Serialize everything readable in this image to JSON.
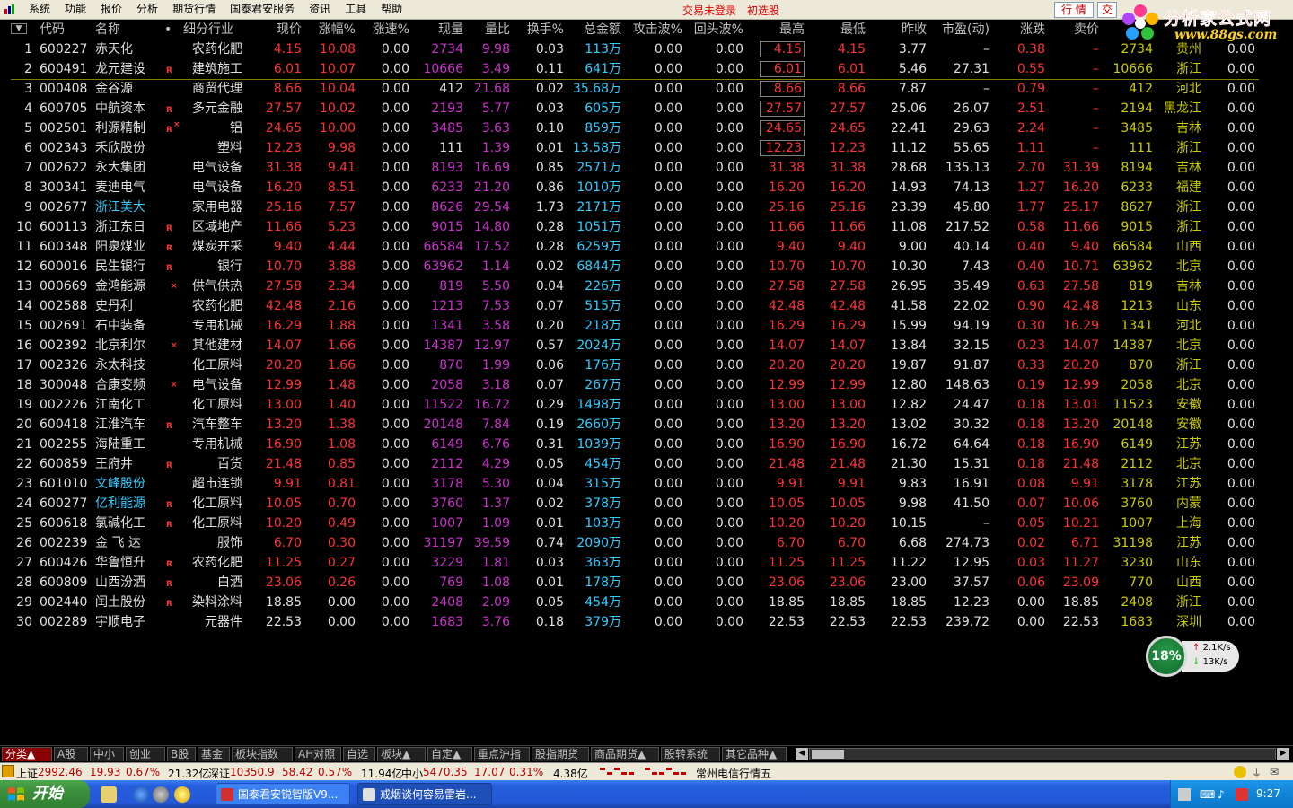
{
  "menubar": {
    "items": [
      "系统",
      "功能",
      "报价",
      "分析",
      "期货行情",
      "国泰君安服务",
      "资讯",
      "工具",
      "帮助"
    ],
    "status_trade": "交易未登录",
    "status_pick": "初选股",
    "hangqing_btn": "行 情",
    "trade_btn": "交易"
  },
  "watermark": {
    "text": "分析家公式网",
    "url": "www.88gs.com"
  },
  "columns": [
    "代码",
    "名称",
    "•",
    "细分行业",
    "现价",
    "涨幅%",
    "涨速%",
    "现量",
    "量比",
    "换手%",
    "总金额",
    "攻击波%",
    "回头波%",
    "最高",
    "最低",
    "昨收",
    "市盈(动)",
    "涨跌",
    "卖价",
    "",
    "",
    ""
  ],
  "rows": [
    {
      "n": "1",
      "code": "600227",
      "name": "赤天化",
      "flag": "",
      "ind": "农药化肥",
      "price": "4.15",
      "pct": "10.08",
      "spd": "0.00",
      "vol": "2734",
      "vr": "9.98",
      "turn": "0.03",
      "amt": "113万",
      "atk": "0.00",
      "bk": "0.00",
      "hi": "4.15",
      "lo": "4.15",
      "pc": "3.77",
      "pe": "–",
      "chg": "0.38",
      "sell": "–",
      "bvol": "2734",
      "area": "贵州",
      "last": "0.00",
      "hibox": true
    },
    {
      "n": "2",
      "code": "600491",
      "name": "龙元建设",
      "flag": "R",
      "ind": "建筑施工",
      "price": "6.01",
      "pct": "10.07",
      "spd": "0.00",
      "vol": "10666",
      "vr": "3.49",
      "turn": "0.11",
      "amt": "641万",
      "atk": "0.00",
      "bk": "0.00",
      "hi": "6.01",
      "lo": "6.01",
      "pc": "5.46",
      "pe": "27.31",
      "chg": "0.55",
      "sell": "–",
      "bvol": "10666",
      "area": "浙江",
      "last": "0.00",
      "hibox": true
    },
    {
      "n": "3",
      "code": "000408",
      "name": "金谷源",
      "flag": "",
      "ind": "商贸代理",
      "price": "8.66",
      "pct": "10.04",
      "spd": "0.00",
      "vol": "412",
      "vr": "21.68",
      "turn": "0.02",
      "amt": "35.68万",
      "atk": "0.00",
      "bk": "0.00",
      "hi": "8.66",
      "lo": "8.66",
      "pc": "7.87",
      "pe": "–",
      "chg": "0.79",
      "sell": "–",
      "bvol": "412",
      "area": "河北",
      "last": "0.00",
      "hibox": true,
      "volw": true
    },
    {
      "n": "4",
      "code": "600705",
      "name": "中航资本",
      "flag": "R",
      "ind": "多元金融",
      "price": "27.57",
      "pct": "10.02",
      "spd": "0.00",
      "vol": "2193",
      "vr": "5.77",
      "turn": "0.03",
      "amt": "605万",
      "atk": "0.00",
      "bk": "0.00",
      "hi": "27.57",
      "lo": "27.57",
      "pc": "25.06",
      "pe": "26.07",
      "chg": "2.51",
      "sell": "–",
      "bvol": "2194",
      "area": "黑龙江",
      "last": "0.00",
      "hibox": true
    },
    {
      "n": "5",
      "code": "002501",
      "name": "利源精制",
      "flag": "R",
      "star": true,
      "ind": "铝",
      "price": "24.65",
      "pct": "10.00",
      "spd": "0.00",
      "vol": "3485",
      "vr": "3.63",
      "turn": "0.10",
      "amt": "859万",
      "atk": "0.00",
      "bk": "0.00",
      "hi": "24.65",
      "lo": "24.65",
      "pc": "22.41",
      "pe": "29.63",
      "chg": "2.24",
      "sell": "–",
      "bvol": "3485",
      "area": "吉林",
      "last": "0.00",
      "hibox": true
    },
    {
      "n": "6",
      "code": "002343",
      "name": "禾欣股份",
      "flag": "",
      "ind": "塑料",
      "price": "12.23",
      "pct": "9.98",
      "spd": "0.00",
      "vol": "111",
      "vr": "1.39",
      "turn": "0.01",
      "amt": "13.58万",
      "atk": "0.00",
      "bk": "0.00",
      "hi": "12.23",
      "lo": "12.23",
      "pc": "11.12",
      "pe": "55.65",
      "chg": "1.11",
      "sell": "–",
      "bvol": "111",
      "area": "浙江",
      "last": "0.00",
      "hibox": true,
      "volw": true
    },
    {
      "n": "7",
      "code": "002622",
      "name": "永大集团",
      "flag": "",
      "ind": "电气设备",
      "price": "31.38",
      "pct": "9.41",
      "spd": "0.00",
      "vol": "8193",
      "vr": "16.69",
      "turn": "0.85",
      "amt": "2571万",
      "atk": "0.00",
      "bk": "0.00",
      "hi": "31.38",
      "lo": "31.38",
      "pc": "28.68",
      "pe": "135.13",
      "chg": "2.70",
      "sell": "31.39",
      "bvol": "8194",
      "area": "吉林",
      "last": "0.00"
    },
    {
      "n": "8",
      "code": "300341",
      "name": "麦迪电气",
      "flag": "",
      "ind": "电气设备",
      "price": "16.20",
      "pct": "8.51",
      "spd": "0.00",
      "vol": "6233",
      "vr": "21.20",
      "turn": "0.86",
      "amt": "1010万",
      "atk": "0.00",
      "bk": "0.00",
      "hi": "16.20",
      "lo": "16.20",
      "pc": "14.93",
      "pe": "74.13",
      "chg": "1.27",
      "sell": "16.20",
      "bvol": "6233",
      "area": "福建",
      "last": "0.00"
    },
    {
      "n": "9",
      "code": "002677",
      "name": "浙江美大",
      "flag": "",
      "ind": "家用电器",
      "price": "25.16",
      "pct": "7.57",
      "spd": "0.00",
      "vol": "8626",
      "vr": "29.54",
      "turn": "1.73",
      "amt": "2171万",
      "atk": "0.00",
      "bk": "0.00",
      "hi": "25.16",
      "lo": "25.16",
      "pc": "23.39",
      "pe": "45.80",
      "chg": "1.77",
      "sell": "25.17",
      "bvol": "8627",
      "area": "浙江",
      "last": "0.00",
      "namecyan": true
    },
    {
      "n": "10",
      "code": "600113",
      "name": "浙江东日",
      "flag": "R",
      "ind": "区域地产",
      "price": "11.66",
      "pct": "5.23",
      "spd": "0.00",
      "vol": "9015",
      "vr": "14.80",
      "turn": "0.28",
      "amt": "1051万",
      "atk": "0.00",
      "bk": "0.00",
      "hi": "11.66",
      "lo": "11.66",
      "pc": "11.08",
      "pe": "217.52",
      "chg": "0.58",
      "sell": "11.66",
      "bvol": "9015",
      "area": "浙江",
      "last": "0.00"
    },
    {
      "n": "11",
      "code": "600348",
      "name": "阳泉煤业",
      "flag": "R",
      "ind": "煤炭开采",
      "price": "9.40",
      "pct": "4.44",
      "spd": "0.00",
      "vol": "66584",
      "vr": "17.52",
      "turn": "0.28",
      "amt": "6259万",
      "atk": "0.00",
      "bk": "0.00",
      "hi": "9.40",
      "lo": "9.40",
      "pc": "9.00",
      "pe": "40.14",
      "chg": "0.40",
      "sell": "9.40",
      "bvol": "66584",
      "area": "山西",
      "last": "0.00"
    },
    {
      "n": "12",
      "code": "600016",
      "name": "民生银行",
      "flag": "R",
      "ind": "银行",
      "price": "10.70",
      "pct": "3.88",
      "spd": "0.00",
      "vol": "63962",
      "vr": "1.14",
      "turn": "0.02",
      "amt": "6844万",
      "atk": "0.00",
      "bk": "0.00",
      "hi": "10.70",
      "lo": "10.70",
      "pc": "10.30",
      "pe": "7.43",
      "chg": "0.40",
      "sell": "10.71",
      "bvol": "63962",
      "area": "北京",
      "last": "0.00"
    },
    {
      "n": "13",
      "code": "000669",
      "name": "金鸿能源",
      "flag": "",
      "star": true,
      "ind": "供气供热",
      "price": "27.58",
      "pct": "2.34",
      "spd": "0.00",
      "vol": "819",
      "vr": "5.50",
      "turn": "0.04",
      "amt": "226万",
      "atk": "0.00",
      "bk": "0.00",
      "hi": "27.58",
      "lo": "27.58",
      "pc": "26.95",
      "pe": "35.49",
      "chg": "0.63",
      "sell": "27.58",
      "bvol": "819",
      "area": "吉林",
      "last": "0.00"
    },
    {
      "n": "14",
      "code": "002588",
      "name": "史丹利",
      "flag": "",
      "ind": "农药化肥",
      "price": "42.48",
      "pct": "2.16",
      "spd": "0.00",
      "vol": "1213",
      "vr": "7.53",
      "turn": "0.07",
      "amt": "515万",
      "atk": "0.00",
      "bk": "0.00",
      "hi": "42.48",
      "lo": "42.48",
      "pc": "41.58",
      "pe": "22.02",
      "chg": "0.90",
      "sell": "42.48",
      "bvol": "1213",
      "area": "山东",
      "last": "0.00"
    },
    {
      "n": "15",
      "code": "002691",
      "name": "石中装备",
      "flag": "",
      "ind": "专用机械",
      "price": "16.29",
      "pct": "1.88",
      "spd": "0.00",
      "vol": "1341",
      "vr": "3.58",
      "turn": "0.20",
      "amt": "218万",
      "atk": "0.00",
      "bk": "0.00",
      "hi": "16.29",
      "lo": "16.29",
      "pc": "15.99",
      "pe": "94.19",
      "chg": "0.30",
      "sell": "16.29",
      "bvol": "1341",
      "area": "河北",
      "last": "0.00"
    },
    {
      "n": "16",
      "code": "002392",
      "name": "北京利尔",
      "flag": "",
      "star": true,
      "ind": "其他建材",
      "price": "14.07",
      "pct": "1.66",
      "spd": "0.00",
      "vol": "14387",
      "vr": "12.97",
      "turn": "0.57",
      "amt": "2024万",
      "atk": "0.00",
      "bk": "0.00",
      "hi": "14.07",
      "lo": "14.07",
      "pc": "13.84",
      "pe": "32.15",
      "chg": "0.23",
      "sell": "14.07",
      "bvol": "14387",
      "area": "北京",
      "last": "0.00"
    },
    {
      "n": "17",
      "code": "002326",
      "name": "永太科技",
      "flag": "",
      "ind": "化工原料",
      "price": "20.20",
      "pct": "1.66",
      "spd": "0.00",
      "vol": "870",
      "vr": "1.99",
      "turn": "0.06",
      "amt": "176万",
      "atk": "0.00",
      "bk": "0.00",
      "hi": "20.20",
      "lo": "20.20",
      "pc": "19.87",
      "pe": "91.87",
      "chg": "0.33",
      "sell": "20.20",
      "bvol": "870",
      "area": "浙江",
      "last": "0.00"
    },
    {
      "n": "18",
      "code": "300048",
      "name": "合康变频",
      "flag": "",
      "star": true,
      "ind": "电气设备",
      "price": "12.99",
      "pct": "1.48",
      "spd": "0.00",
      "vol": "2058",
      "vr": "3.18",
      "turn": "0.07",
      "amt": "267万",
      "atk": "0.00",
      "bk": "0.00",
      "hi": "12.99",
      "lo": "12.99",
      "pc": "12.80",
      "pe": "148.63",
      "chg": "0.19",
      "sell": "12.99",
      "bvol": "2058",
      "area": "北京",
      "last": "0.00"
    },
    {
      "n": "19",
      "code": "002226",
      "name": "江南化工",
      "flag": "",
      "ind": "化工原料",
      "price": "13.00",
      "pct": "1.40",
      "spd": "0.00",
      "vol": "11522",
      "vr": "16.72",
      "turn": "0.29",
      "amt": "1498万",
      "atk": "0.00",
      "bk": "0.00",
      "hi": "13.00",
      "lo": "13.00",
      "pc": "12.82",
      "pe": "24.47",
      "chg": "0.18",
      "sell": "13.01",
      "bvol": "11523",
      "area": "安徽",
      "last": "0.00"
    },
    {
      "n": "20",
      "code": "600418",
      "name": "江淮汽车",
      "flag": "R",
      "ind": "汽车整车",
      "price": "13.20",
      "pct": "1.38",
      "spd": "0.00",
      "vol": "20148",
      "vr": "7.84",
      "turn": "0.19",
      "amt": "2660万",
      "atk": "0.00",
      "bk": "0.00",
      "hi": "13.20",
      "lo": "13.20",
      "pc": "13.02",
      "pe": "30.32",
      "chg": "0.18",
      "sell": "13.20",
      "bvol": "20148",
      "area": "安徽",
      "last": "0.00"
    },
    {
      "n": "21",
      "code": "002255",
      "name": "海陆重工",
      "flag": "",
      "ind": "专用机械",
      "price": "16.90",
      "pct": "1.08",
      "spd": "0.00",
      "vol": "6149",
      "vr": "6.76",
      "turn": "0.31",
      "amt": "1039万",
      "atk": "0.00",
      "bk": "0.00",
      "hi": "16.90",
      "lo": "16.90",
      "pc": "16.72",
      "pe": "64.64",
      "chg": "0.18",
      "sell": "16.90",
      "bvol": "6149",
      "area": "江苏",
      "last": "0.00"
    },
    {
      "n": "22",
      "code": "600859",
      "name": "王府井",
      "flag": "R",
      "ind": "百货",
      "price": "21.48",
      "pct": "0.85",
      "spd": "0.00",
      "vol": "2112",
      "vr": "4.29",
      "turn": "0.05",
      "amt": "454万",
      "atk": "0.00",
      "bk": "0.00",
      "hi": "21.48",
      "lo": "21.48",
      "pc": "21.30",
      "pe": "15.31",
      "chg": "0.18",
      "sell": "21.48",
      "bvol": "2112",
      "area": "北京",
      "last": "0.00"
    },
    {
      "n": "23",
      "code": "601010",
      "name": "文峰股份",
      "flag": "",
      "ind": "超市连锁",
      "price": "9.91",
      "pct": "0.81",
      "spd": "0.00",
      "vol": "3178",
      "vr": "5.30",
      "turn": "0.04",
      "amt": "315万",
      "atk": "0.00",
      "bk": "0.00",
      "hi": "9.91",
      "lo": "9.91",
      "pc": "9.83",
      "pe": "16.91",
      "chg": "0.08",
      "sell": "9.91",
      "bvol": "3178",
      "area": "江苏",
      "last": "0.00",
      "namecyan": true
    },
    {
      "n": "24",
      "code": "600277",
      "name": "亿利能源",
      "flag": "R",
      "ind": "化工原料",
      "price": "10.05",
      "pct": "0.70",
      "spd": "0.00",
      "vol": "3760",
      "vr": "1.37",
      "turn": "0.02",
      "amt": "378万",
      "atk": "0.00",
      "bk": "0.00",
      "hi": "10.05",
      "lo": "10.05",
      "pc": "9.98",
      "pe": "41.50",
      "chg": "0.07",
      "sell": "10.06",
      "bvol": "3760",
      "area": "内蒙",
      "last": "0.00",
      "namecyan": true
    },
    {
      "n": "25",
      "code": "600618",
      "name": "氯碱化工",
      "flag": "R",
      "ind": "化工原料",
      "price": "10.20",
      "pct": "0.49",
      "spd": "0.00",
      "vol": "1007",
      "vr": "1.09",
      "turn": "0.01",
      "amt": "103万",
      "atk": "0.00",
      "bk": "0.00",
      "hi": "10.20",
      "lo": "10.20",
      "pc": "10.15",
      "pe": "–",
      "chg": "0.05",
      "sell": "10.21",
      "bvol": "1007",
      "area": "上海",
      "last": "0.00"
    },
    {
      "n": "26",
      "code": "002239",
      "name": "金 飞 达",
      "flag": "",
      "ind": "服饰",
      "price": "6.70",
      "pct": "0.30",
      "spd": "0.00",
      "vol": "31197",
      "vr": "39.59",
      "turn": "0.74",
      "amt": "2090万",
      "atk": "0.00",
      "bk": "0.00",
      "hi": "6.70",
      "lo": "6.70",
      "pc": "6.68",
      "pe": "274.73",
      "chg": "0.02",
      "sell": "6.71",
      "bvol": "31198",
      "area": "江苏",
      "last": "0.00"
    },
    {
      "n": "27",
      "code": "600426",
      "name": "华鲁恒升",
      "flag": "R",
      "ind": "农药化肥",
      "price": "11.25",
      "pct": "0.27",
      "spd": "0.00",
      "vol": "3229",
      "vr": "1.81",
      "turn": "0.03",
      "amt": "363万",
      "atk": "0.00",
      "bk": "0.00",
      "hi": "11.25",
      "lo": "11.25",
      "pc": "11.22",
      "pe": "12.95",
      "chg": "0.03",
      "sell": "11.27",
      "bvol": "3230",
      "area": "山东",
      "last": "0.00"
    },
    {
      "n": "28",
      "code": "600809",
      "name": "山西汾酒",
      "flag": "R",
      "ind": "白酒",
      "price": "23.06",
      "pct": "0.26",
      "spd": "0.00",
      "vol": "769",
      "vr": "1.08",
      "turn": "0.01",
      "amt": "178万",
      "atk": "0.00",
      "bk": "0.00",
      "hi": "23.06",
      "lo": "23.06",
      "pc": "23.00",
      "pe": "37.57",
      "chg": "0.06",
      "sell": "23.09",
      "bvol": "770",
      "area": "山西",
      "last": "0.00"
    },
    {
      "n": "29",
      "code": "002440",
      "name": "闰土股份",
      "flag": "R",
      "ind": "染料涂料",
      "price": "18.85",
      "pct": "0.00",
      "spd": "0.00",
      "vol": "2408",
      "vr": "2.09",
      "turn": "0.05",
      "amt": "454万",
      "atk": "0.00",
      "bk": "0.00",
      "hi": "18.85",
      "lo": "18.85",
      "pc": "18.85",
      "pe": "12.23",
      "chg": "0.00",
      "sell": "18.85",
      "bvol": "2408",
      "area": "浙江",
      "last": "0.00",
      "flat": true
    },
    {
      "n": "30",
      "code": "002289",
      "name": "宇顺电子",
      "flag": "",
      "ind": "元器件",
      "price": "22.53",
      "pct": "0.00",
      "spd": "0.00",
      "vol": "1683",
      "vr": "3.76",
      "turn": "0.18",
      "amt": "379万",
      "atk": "0.00",
      "bk": "0.00",
      "hi": "22.53",
      "lo": "22.53",
      "pc": "22.53",
      "pe": "239.72",
      "chg": "0.00",
      "sell": "22.53",
      "bvol": "1683",
      "area": "深圳",
      "last": "0.00",
      "flat": true
    }
  ],
  "tabs": [
    "分类▲",
    "A股",
    "中小",
    "创业",
    "B股",
    "基金",
    "板块指数",
    "AH对照",
    "自选",
    "板块▲",
    "自定▲",
    "重点沪指",
    "股指期货",
    "商品期货▲",
    "股转系统",
    "其它品种▲"
  ],
  "indexbar": {
    "sh_label": "上证",
    "sh_val": "2992.46",
    "sh_chg": "19.93",
    "sh_pct": "0.67%",
    "sh_amt": "21.32亿",
    "sz_label": "深证",
    "sz_val": "10350.9",
    "sz_chg": "58.42",
    "sz_pct": "0.57%",
    "sz_amt": "11.94亿",
    "zx_label": "中小",
    "zx_val": "5470.35",
    "zx_chg": "17.07",
    "zx_pct": "0.31%",
    "zx_amt": "4.38亿",
    "server": "常州电信行情五"
  },
  "netwidget": {
    "pct": "18%",
    "up": "2.1K/s",
    "down": "13K/s"
  },
  "taskbar": {
    "start": "开始",
    "task1": "国泰君安锐智版V9...",
    "task2": "戒烟谈何容易雷岩...",
    "clock": "9:27"
  },
  "colors": {
    "up": "#ff3333",
    "vol": "#cc33cc",
    "amt": "#33ccff",
    "label": "#c0c0c0",
    "area": "#cccc00"
  }
}
